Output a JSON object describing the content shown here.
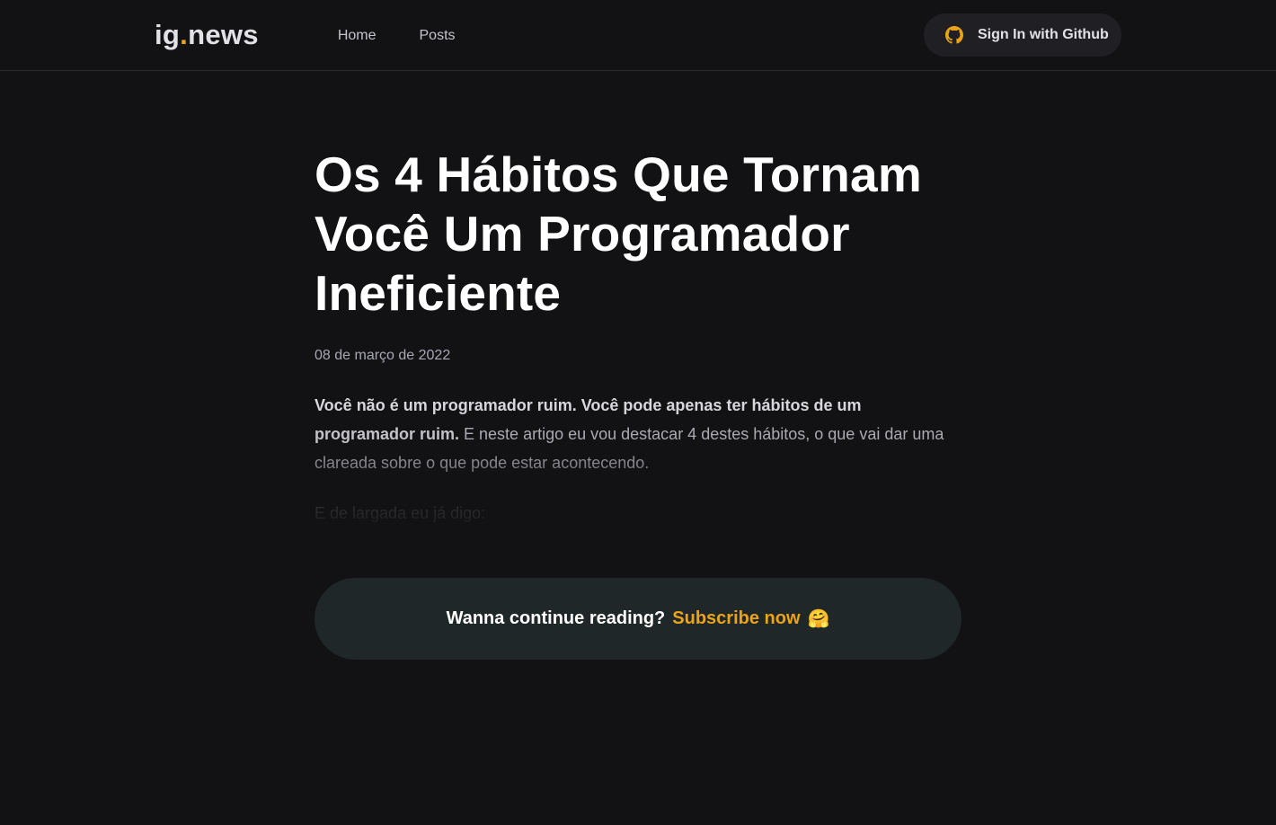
{
  "header": {
    "logo_text": "ig",
    "logo_dot": ".",
    "logo_suffix": "news",
    "nav": [
      {
        "label": "Home"
      },
      {
        "label": "Posts"
      }
    ],
    "signin_label": "Sign In with Github"
  },
  "post": {
    "title": "Os 4 Hábitos Que Tornam Você Um Programador Ineficiente",
    "date": "08 de março de 2022",
    "intro_bold": "Você não é um programador ruim. Você pode apenas ter hábitos de um programador ruim.",
    "intro_rest": " E neste artigo eu vou destacar 4 destes hábitos, o que vai dar uma clareada sobre o que pode estar acontecendo.",
    "second_paragraph": "E de largada eu já digo:"
  },
  "cta": {
    "question": "Wanna continue reading?",
    "link": "Subscribe now",
    "emoji": "🤗"
  },
  "colors": {
    "background": "#121214",
    "accent": "#eba417",
    "cta_bg": "#1f2729",
    "button_bg": "#202024"
  },
  "icons": {
    "github": "github-icon"
  }
}
